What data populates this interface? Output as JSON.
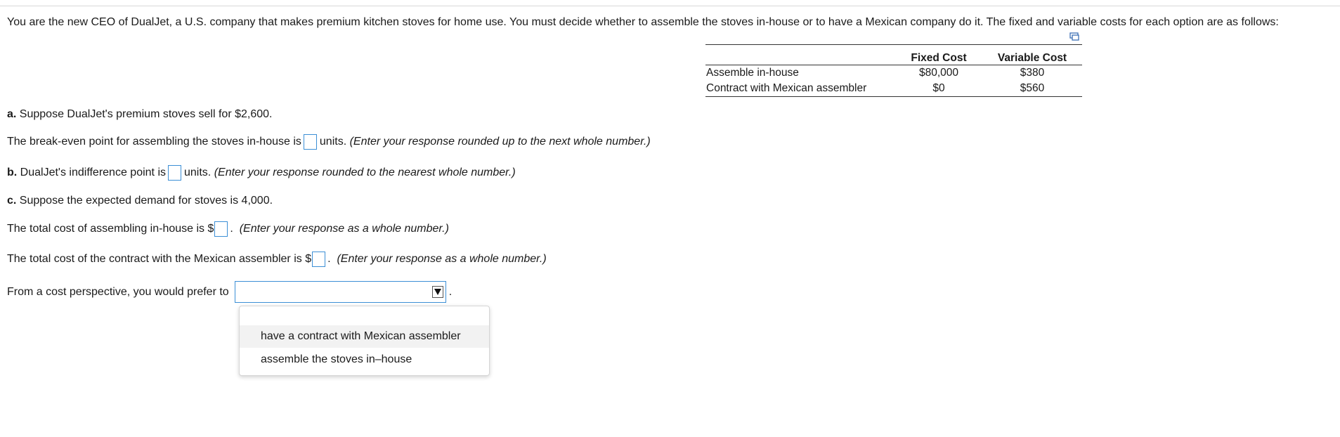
{
  "intro": "You are the new CEO of DualJet, a U.S. company that makes premium kitchen stoves for home use. You must decide whether to assemble the stoves in-house or to have a Mexican company do it. The fixed and variable costs for each option are as follows:",
  "table": {
    "headers": [
      "",
      "Fixed Cost",
      "Variable Cost"
    ],
    "rows": [
      {
        "label": "Assemble in-house",
        "fixed": "$80,000",
        "variable": "$380"
      },
      {
        "label": "Contract with Mexican assembler",
        "fixed": "$0",
        "variable": "$560"
      }
    ]
  },
  "part_a": {
    "letter": "a.",
    "text": "Suppose DualJet's premium stoves sell for $2,600.",
    "q1_before": "The break-even point for assembling the stoves in-house is",
    "q1_after": "units.",
    "q1_hint": "(Enter your response rounded up to the next whole number.)"
  },
  "part_b": {
    "letter": "b.",
    "before": "DualJet's indifference point is",
    "after": "units.",
    "hint": "(Enter your response rounded to the nearest whole number.)"
  },
  "part_c": {
    "letter": "c.",
    "text": "Suppose the expected demand for stoves is 4,000.",
    "q1_before": "The total cost of assembling in-house is $",
    "q1_after": ".",
    "q1_hint": "(Enter your response as a whole number.)",
    "q2_before": "The total cost of the contract with the Mexican assembler is $",
    "q2_after": ".",
    "q2_hint": "(Enter your response as a whole number.)",
    "q3_before": "From a cost perspective, you would prefer to",
    "q3_after": ".",
    "selected": ""
  },
  "dropdown": {
    "options": [
      "have a contract with Mexican assembler",
      "assemble the stoves in–house"
    ]
  },
  "icons": {
    "copy": "copy-table-icon",
    "select_arrow": "triangle-down-icon"
  },
  "colors": {
    "input_border": "#3c8fd6",
    "option_hover": "#f2f2f2"
  }
}
